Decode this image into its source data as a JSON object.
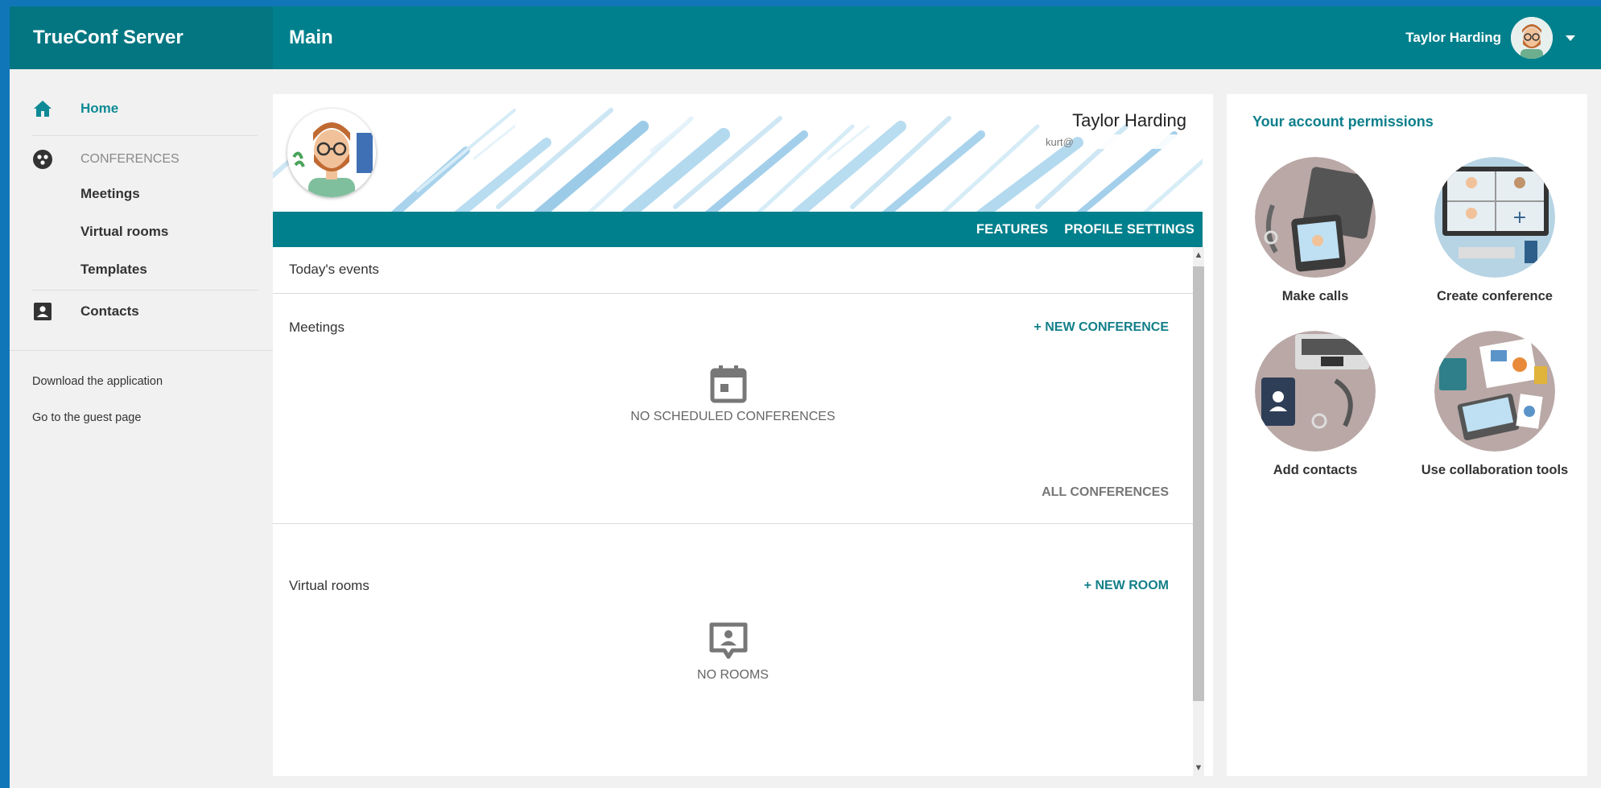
{
  "header": {
    "brand": "TrueConf Server",
    "title": "Main",
    "user_name": "Taylor Harding"
  },
  "sidebar": {
    "home": "Home",
    "conferences_section": "CONFERENCES",
    "meetings": "Meetings",
    "virtual_rooms": "Virtual rooms",
    "templates": "Templates",
    "contacts": "Contacts",
    "download_app": "Download the application",
    "guest_page": "Go to the guest page"
  },
  "profile": {
    "name": "Taylor Harding",
    "email": "kurt@"
  },
  "tabs": {
    "features": "FEATURES",
    "profile_settings": "PROFILE SETTINGS"
  },
  "events": {
    "title": "Today's events",
    "meetings": {
      "title": "Meetings",
      "action": "+ NEW CONFERENCE",
      "empty": "NO SCHEDULED CONFERENCES",
      "all_link": "ALL CONFERENCES"
    },
    "rooms": {
      "title": "Virtual rooms",
      "action": "+ NEW ROOM",
      "empty": "NO ROOMS"
    }
  },
  "permissions": {
    "title": "Your account permissions",
    "items": [
      {
        "label": "Make calls",
        "icon": "make-calls-illustration"
      },
      {
        "label": "Create conference",
        "icon": "create-conference-illustration"
      },
      {
        "label": "Add contacts",
        "icon": "add-contacts-illustration"
      },
      {
        "label": "Use collaboration tools",
        "icon": "collaboration-tools-illustration"
      }
    ]
  },
  "colors": {
    "teal": "#00808c",
    "teal_dark": "#037681",
    "accent": "#137f8a",
    "outer_blue": "#1176b8"
  }
}
